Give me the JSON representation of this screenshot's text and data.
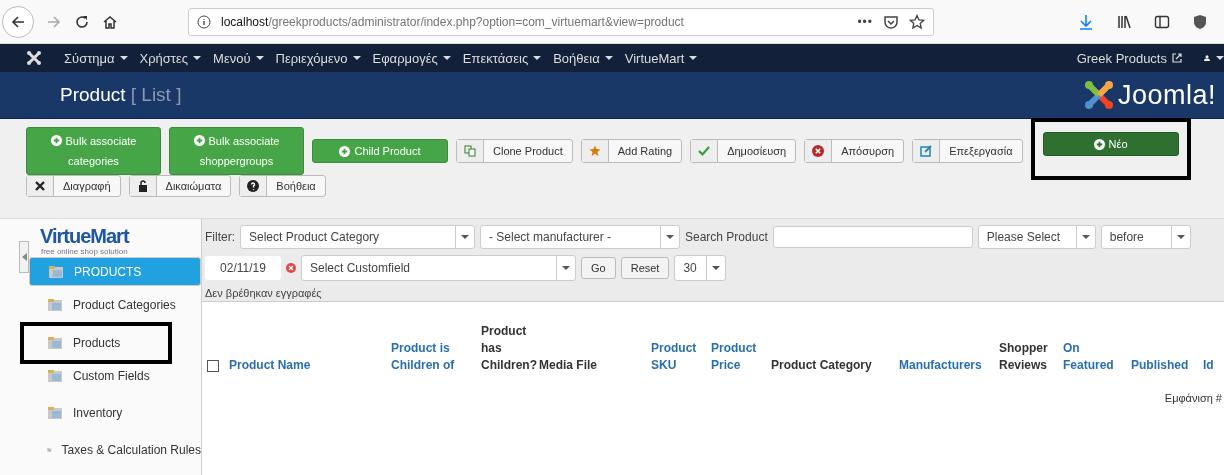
{
  "browser": {
    "url_host": "localhost",
    "url_path": "/greekproducts/administrator/index.php?option=com_virtuemart&view=product",
    "more": "•••"
  },
  "nav": {
    "menus": [
      {
        "label": "Σύστημα"
      },
      {
        "label": "Χρήστες"
      },
      {
        "label": "Μενού"
      },
      {
        "label": "Περιεχόμενο"
      },
      {
        "label": "Εφαρμογές"
      },
      {
        "label": "Επεκτάσεις"
      },
      {
        "label": "Βοήθεια"
      },
      {
        "label": "VirtueMart"
      }
    ],
    "site_link": "Greek Products"
  },
  "header": {
    "title": "Product",
    "subtitle": "[ List ]",
    "logo": "Joomla!"
  },
  "toolbar": {
    "rows": [
      [
        {
          "label": "Bulk associate categories",
          "kind": "success",
          "highlighted": false
        },
        {
          "label": "Bulk associate shoppergroups",
          "kind": "success",
          "highlighted": false
        },
        {
          "label": "Child Product",
          "kind": "success",
          "highlighted": false
        },
        {
          "label": "Clone Product",
          "kind": "default",
          "highlighted": false
        },
        {
          "label": "Add Rating",
          "kind": "default",
          "highlighted": false
        },
        {
          "label": "Δημοσίευση",
          "kind": "default",
          "highlighted": false
        },
        {
          "label": "Απόσυρση",
          "kind": "default",
          "highlighted": false
        },
        {
          "label": "Επεξεργασία",
          "kind": "default",
          "highlighted": false
        },
        {
          "label": "Νέο",
          "kind": "primary",
          "highlighted": true
        }
      ],
      [
        {
          "label": "Διαγραφή",
          "kind": "default",
          "highlighted": false
        },
        {
          "label": "Δικαιώματα",
          "kind": "default",
          "highlighted": false
        },
        {
          "label": "Βοήθεια",
          "kind": "default",
          "highlighted": false
        }
      ]
    ]
  },
  "sidebar": {
    "logo": "VirtueMart",
    "tagline": "free online shop solution",
    "items": [
      {
        "label": "PRODUCTS",
        "selected": true,
        "highlighted": false
      },
      {
        "label": "Product Categories",
        "selected": false,
        "highlighted": false
      },
      {
        "label": "Products",
        "selected": false,
        "highlighted": true
      },
      {
        "label": "Custom Fields",
        "selected": false,
        "highlighted": false
      },
      {
        "label": "Inventory",
        "selected": false,
        "highlighted": false
      },
      {
        "label": "Taxes & Calculation Rules",
        "selected": false,
        "highlighted": false
      }
    ]
  },
  "filters": {
    "filter_label": "Filter:",
    "category": "Select Product Category",
    "manufacturer": "- Select manufacturer -",
    "search_label": "Search Product",
    "status": "Please Select",
    "when": "before",
    "date": "02/11/19",
    "customfield": "Select Customfield",
    "go": "Go",
    "reset": "Reset",
    "limit": "30",
    "message": "Δεν βρέθηκαν εγγραφές"
  },
  "table": {
    "select_all_checked": false,
    "columns": [
      {
        "label": "Product Name",
        "sortable": true
      },
      {
        "label": "Product is Children of",
        "sortable": true
      },
      {
        "label": "Product has Children?",
        "sortable": false
      },
      {
        "label": "Media File",
        "sortable": false
      },
      {
        "label": "Product SKU",
        "sortable": true
      },
      {
        "label": "Product Price",
        "sortable": true
      },
      {
        "label": "Product Category",
        "sortable": false
      },
      {
        "label": "Manufacturers",
        "sortable": true
      },
      {
        "label": "Shopper Reviews",
        "sortable": false
      },
      {
        "label": "On Featured",
        "sortable": true
      },
      {
        "label": "Published",
        "sortable": true
      },
      {
        "label": "Id",
        "sortable": true
      }
    ],
    "display_label": "Εμφάνιση #"
  }
}
